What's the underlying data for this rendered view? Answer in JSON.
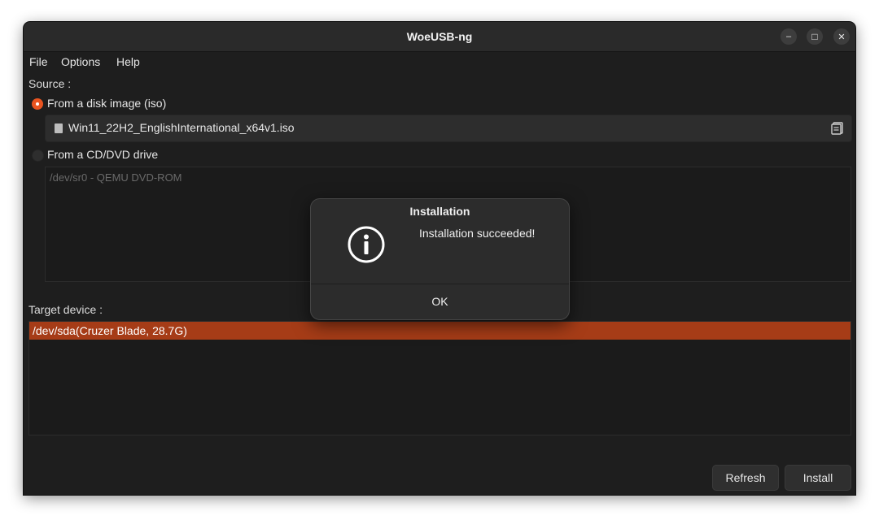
{
  "window": {
    "title": "WoeUSB-ng",
    "controls": {
      "minimize": "–",
      "maximize": "□",
      "close": "✕"
    }
  },
  "menu": {
    "file": "File",
    "options": "Options",
    "help": "Help"
  },
  "source": {
    "label": "Source :",
    "disk_image_option": "From a disk image (iso)",
    "disk_image_selected": true,
    "iso_filename": "Win11_22H2_EnglishInternational_x64v1.iso",
    "cd_option": "From a CD/DVD drive",
    "cd_selected": false,
    "cd_devices": [
      "/dev/sr0 - QEMU DVD-ROM"
    ]
  },
  "target": {
    "label": "Target device :",
    "devices": [
      "/dev/sda(Cruzer Blade, 28.7G)"
    ]
  },
  "buttons": {
    "refresh": "Refresh",
    "install": "Install"
  },
  "dialog": {
    "title": "Installation",
    "message": "Installation succeeded!",
    "ok": "OK",
    "icon": "info-icon"
  },
  "colors": {
    "accent": "#e95420",
    "selection": "#a63c17",
    "background": "#1e1e1e"
  }
}
